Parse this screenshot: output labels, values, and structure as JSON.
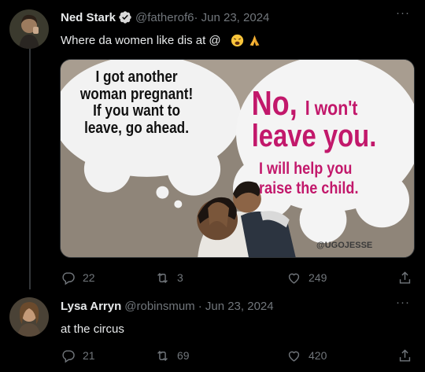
{
  "tweets": [
    {
      "display_name": "Ned Stark",
      "handle": "@fatherof6",
      "date": "· Jun 23, 2024",
      "text": "Where da women like dis at @",
      "verified": true,
      "emojis": [
        "weary-face",
        "folded-hands"
      ],
      "media": {
        "left_bubble": [
          "I got another",
          "woman pregnant!",
          "If you want to",
          "leave, go ahead."
        ],
        "right_no": "No,",
        "right_wont": "I won't",
        "right_leave": "leave you.",
        "right_help_1": "I will help you",
        "right_help_2": "raise the child.",
        "watermark": "@UGOJESSE"
      },
      "stats": {
        "replies": "22",
        "reposts": "3",
        "likes": "249"
      }
    },
    {
      "display_name": "Lysa Arryn",
      "handle": "@robinsmum",
      "date": "· Jun 23, 2024",
      "text": "at the circus",
      "verified": false,
      "stats": {
        "replies": "21",
        "reposts": "69",
        "likes": "420"
      }
    }
  ],
  "colors": {
    "background": "#000000",
    "text_primary": "#e7e9ea",
    "text_secondary": "#71767b",
    "verified_badge": "#d8d8d8",
    "meme_magenta": "#c2186b"
  },
  "icons": {
    "more": "more-horizontal-icon",
    "reply": "reply-icon",
    "repost": "repost-icon",
    "like": "heart-icon",
    "share": "share-icon"
  }
}
